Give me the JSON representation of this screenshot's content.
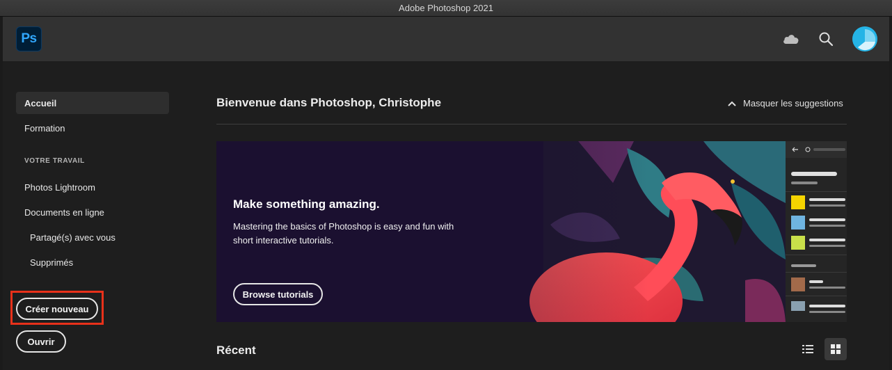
{
  "window": {
    "title": "Adobe Photoshop 2021"
  },
  "header": {
    "logo_text": "Ps",
    "icons": [
      "cloud-icon",
      "search-icon",
      "avatar"
    ],
    "colors": {
      "logo_bg": "#001e36",
      "logo_text": "#31a8ff",
      "avatar": "#25b4e6"
    }
  },
  "sidebar": {
    "items": [
      {
        "label": "Accueil",
        "active": true
      },
      {
        "label": "Formation",
        "active": false
      }
    ],
    "section_title": "VOTRE TRAVAIL",
    "work_items": [
      {
        "label": "Photos Lightroom"
      },
      {
        "label": "Documents en ligne"
      },
      {
        "label": "Partagé(s) avec vous"
      },
      {
        "label": "Supprimés"
      }
    ],
    "create_label": "Créer nouveau",
    "open_label": "Ouvrir",
    "highlight_color": "#e8311a"
  },
  "main": {
    "welcome": "Bienvenue dans Photoshop, Christophe",
    "hide_suggestions": "Masquer les suggestions",
    "banner": {
      "title": "Make something amazing.",
      "text": "Mastering the basics of Photoshop is easy and fun with short interactive tutorials.",
      "button": "Browse tutorials"
    },
    "recent_title": "Récent",
    "view_modes": [
      "list-view",
      "grid-view"
    ],
    "active_view": "grid-view"
  }
}
